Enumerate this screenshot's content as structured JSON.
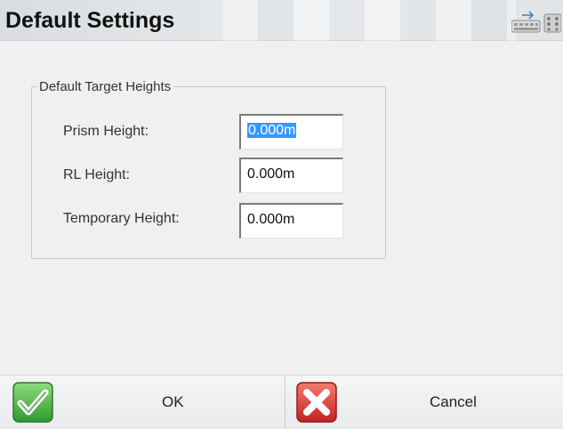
{
  "window": {
    "title": "Default Settings"
  },
  "icons": {
    "keyboard": "keyboard-icon",
    "ok": "checkmark-icon",
    "cancel": "x-icon"
  },
  "group": {
    "legend": "Default Target Heights",
    "rows": [
      {
        "label": "Prism Height:",
        "value": "0.000m",
        "selected": true
      },
      {
        "label": "RL Height:",
        "value": "0.000m",
        "selected": false
      },
      {
        "label": "Temporary Height:",
        "value": "0.000m",
        "selected": false
      }
    ]
  },
  "footer": {
    "ok_label": "OK",
    "cancel_label": "Cancel"
  },
  "colors": {
    "ok_green": "#3aa63a",
    "cancel_red": "#d9322d",
    "selection": "#3399ff"
  }
}
